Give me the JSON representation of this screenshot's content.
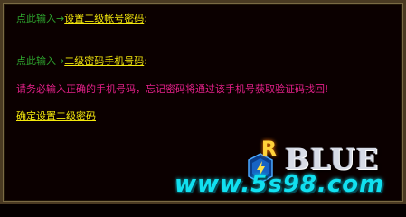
{
  "row1": {
    "prefix": "点此输入→",
    "link": "设置二级帐号密码",
    "suffix": ":"
  },
  "row2": {
    "prefix": "点此输入→",
    "link": "二级密码手机号码",
    "suffix": ":"
  },
  "notice": "请务必输入正确的手机号码，忘记密码将通过该手机号获取验证码找回!",
  "confirm_link": "确定设置二级密码",
  "watermark": {
    "brand": "BLUE",
    "site": "www.5s98.com",
    "r_glyph": "R"
  },
  "colors": {
    "prompt": "#2ea62e",
    "link": "#f4e80c",
    "notice": "#e6208a",
    "background": "#0b0000"
  }
}
